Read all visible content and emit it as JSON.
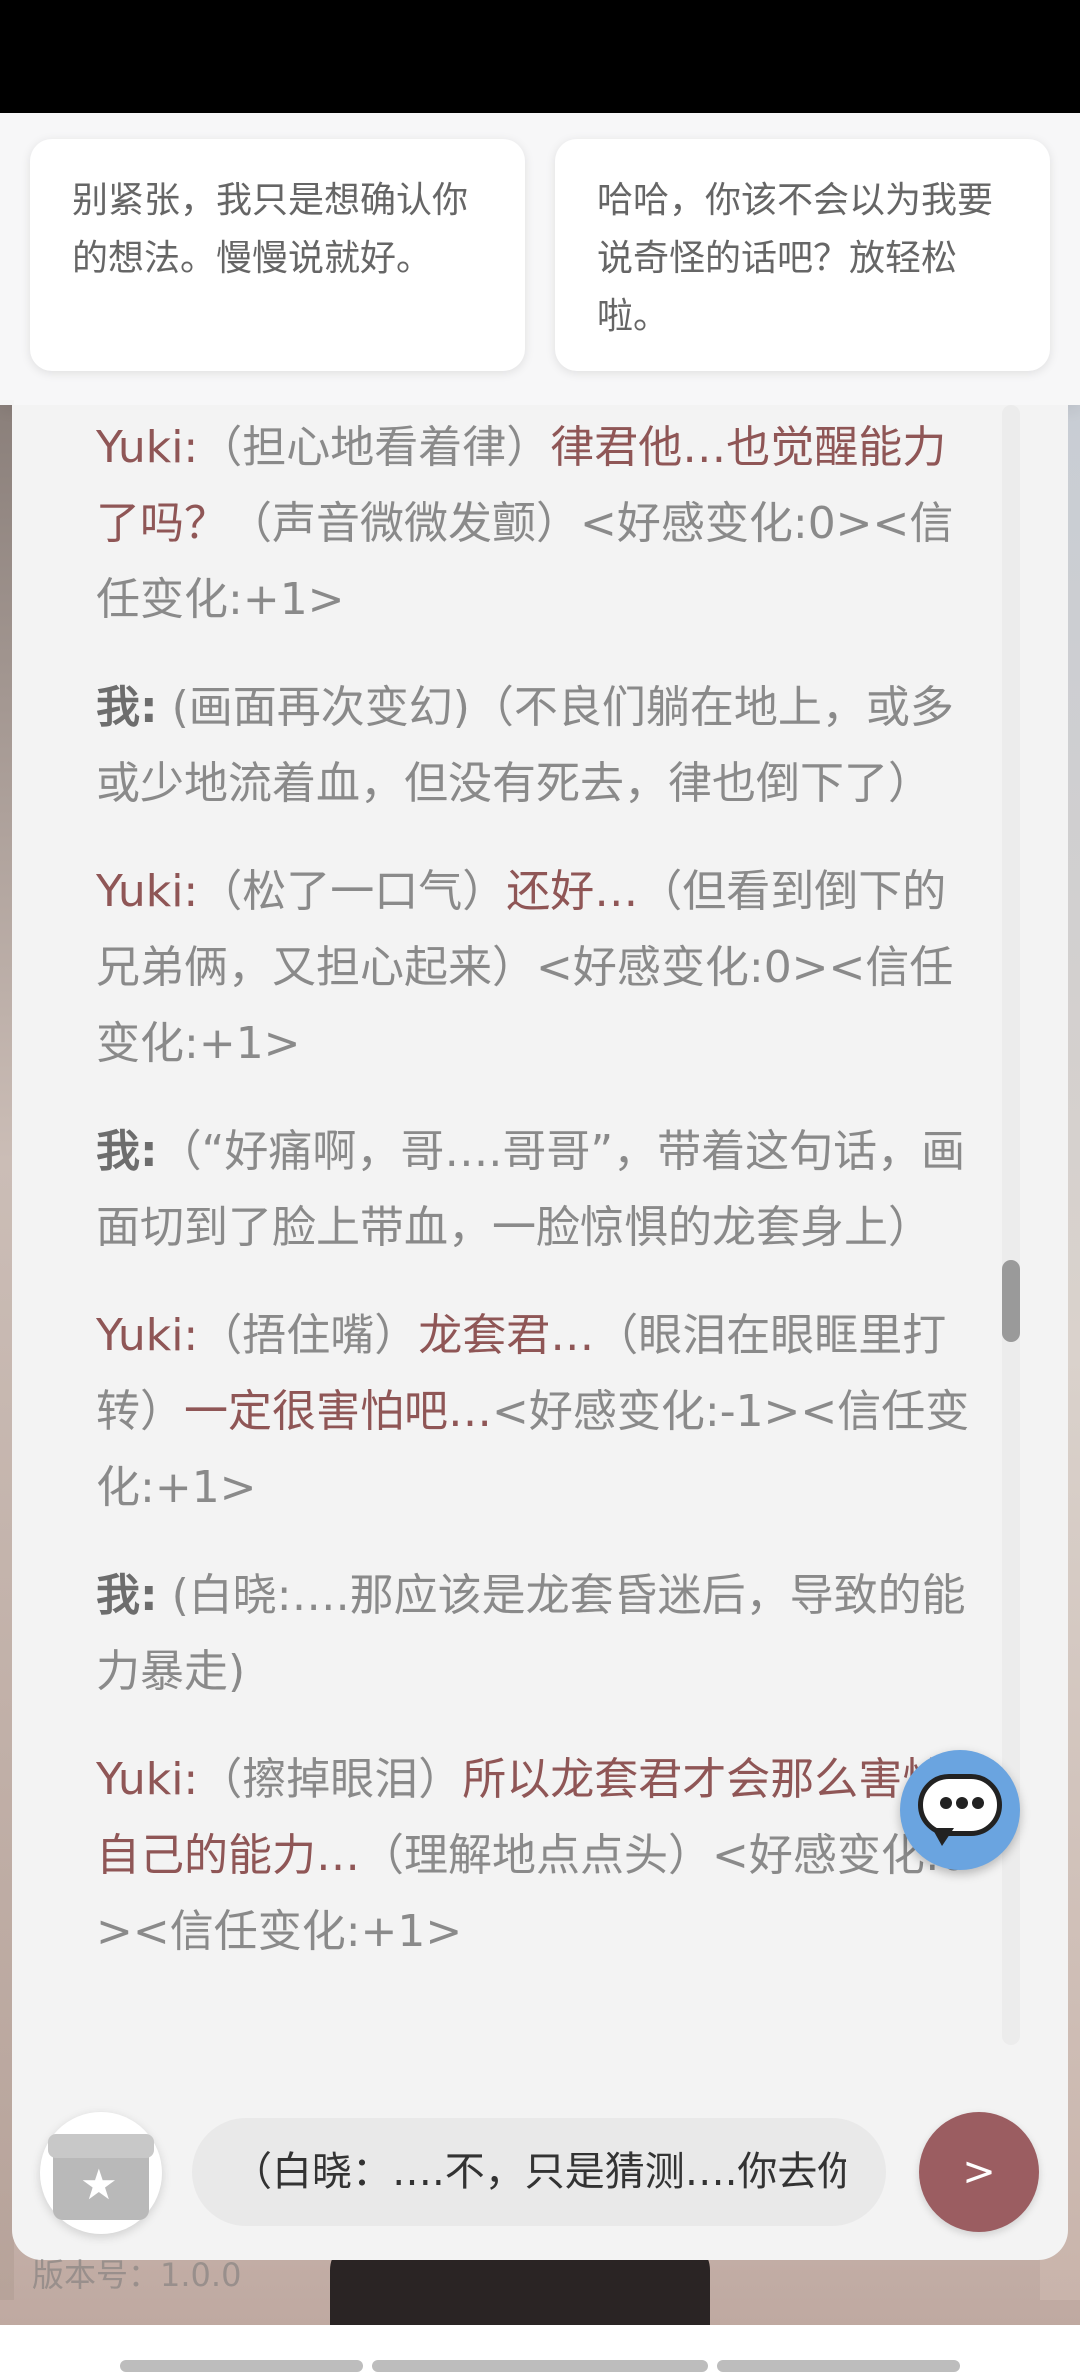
{
  "suggestions": [
    "别紧张，我只是想确认你的想法。慢慢说就好。",
    "哈哈，你该不会以为我要说奇怪的话吧？放轻松啦。"
  ],
  "messages": [
    {
      "role": "ai",
      "speaker": "Yuki:",
      "parts": [
        {
          "t": "（担心地看着律）",
          "hl": false
        },
        {
          "t": "律君他…也觉醒能力了吗？",
          "hl": true
        },
        {
          "t": "（声音微微发颤）<好感变化:0><信任变化:+1>",
          "hl": false
        }
      ]
    },
    {
      "role": "user",
      "speaker": "我:",
      "parts": [
        {
          "t": " (画面再次变幻)（不良们躺在地上，或多或少地流着血，但没有死去，律也倒下了）",
          "hl": false
        }
      ]
    },
    {
      "role": "ai",
      "speaker": "Yuki:",
      "parts": [
        {
          "t": "（松了一口气）",
          "hl": false
        },
        {
          "t": "还好…",
          "hl": true
        },
        {
          "t": "（但看到倒下的兄弟俩，又担心起来）<好感变化:0><信任变化:+1>",
          "hl": false
        }
      ]
    },
    {
      "role": "user",
      "speaker": "我:",
      "parts": [
        {
          "t": "（“好痛啊，哥….哥哥”，带着这句话，画面切到了脸上带血，一脸惊惧的龙套身上）",
          "hl": false
        }
      ]
    },
    {
      "role": "ai",
      "speaker": "Yuki:",
      "parts": [
        {
          "t": "（捂住嘴）",
          "hl": false
        },
        {
          "t": "龙套君…",
          "hl": true
        },
        {
          "t": "（眼泪在眼眶里打转）",
          "hl": false
        },
        {
          "t": "一定很害怕吧…",
          "hl": true
        },
        {
          "t": "<好感变化:-1><信任变化:+1>",
          "hl": false
        }
      ]
    },
    {
      "role": "user",
      "speaker": "我:",
      "parts": [
        {
          "t": " (白晓:….那应该是龙套昏迷后，导致的能力暴走)",
          "hl": false
        }
      ]
    },
    {
      "role": "ai",
      "speaker": "Yuki:",
      "parts": [
        {
          "t": "（擦掉眼泪）",
          "hl": false
        },
        {
          "t": "所以龙套君才会那么害怕自己的能力…",
          "hl": true
        },
        {
          "t": "（理解地点点头）<好感变化:0><信任变化:+1>",
          "hl": false
        }
      ]
    }
  ],
  "input": {
    "value": "（白晓：….不，只是猜测….你去你"
  },
  "send_label": ">",
  "version_label": "版本号：1.0.0",
  "colors": {
    "accent": "#9b5d61",
    "ai_text": "#8f5656",
    "fab": "#6aa4e0"
  },
  "icons": {
    "gift": "gift-icon",
    "chat": "chat-bubble-icon"
  }
}
